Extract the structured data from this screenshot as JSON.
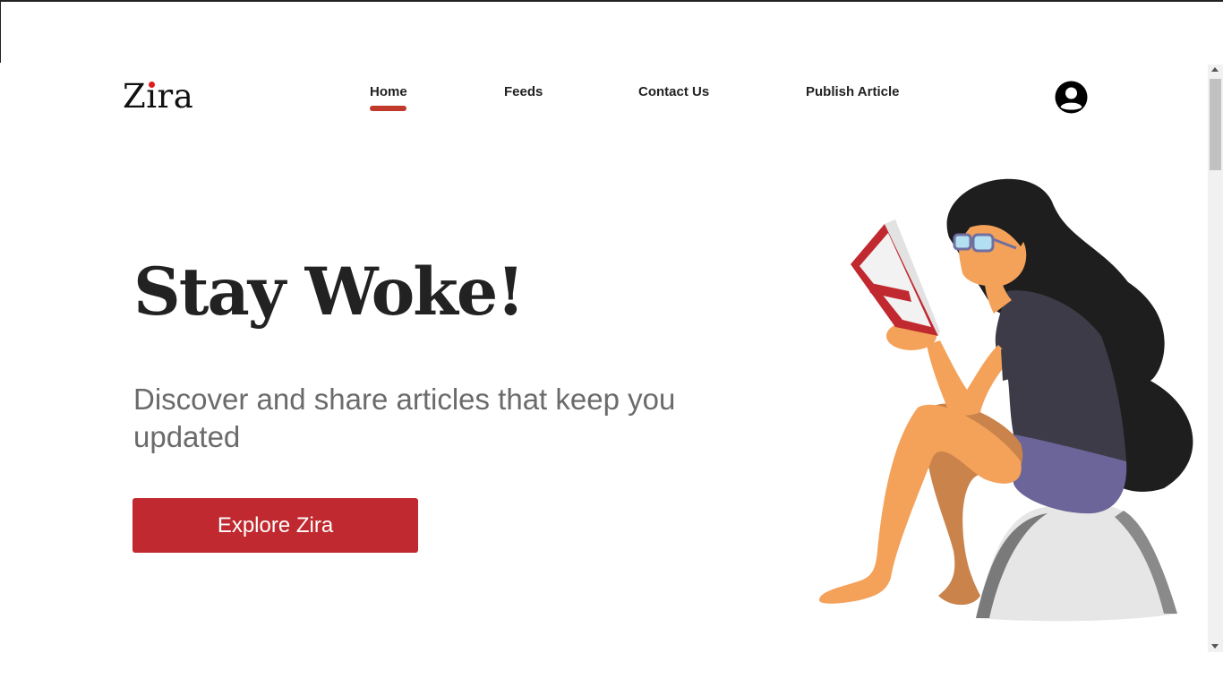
{
  "brand": {
    "name": "Zira",
    "dot_color": "#e01b1b"
  },
  "nav": {
    "items": [
      {
        "label": "Home",
        "active": true
      },
      {
        "label": "Feeds",
        "active": false
      },
      {
        "label": "Contact Us",
        "active": false
      },
      {
        "label": "Publish Article",
        "active": false
      }
    ],
    "active_color": "#c0392b"
  },
  "header": {
    "profile_icon": "user-circle-icon"
  },
  "hero": {
    "headline": "Stay Woke!",
    "subtitle": "Discover and share articles that keep you updated",
    "cta_label": "Explore Zira",
    "cta_color": "#c0292f",
    "illustration_icon": "woman-reading-book-illustration"
  }
}
